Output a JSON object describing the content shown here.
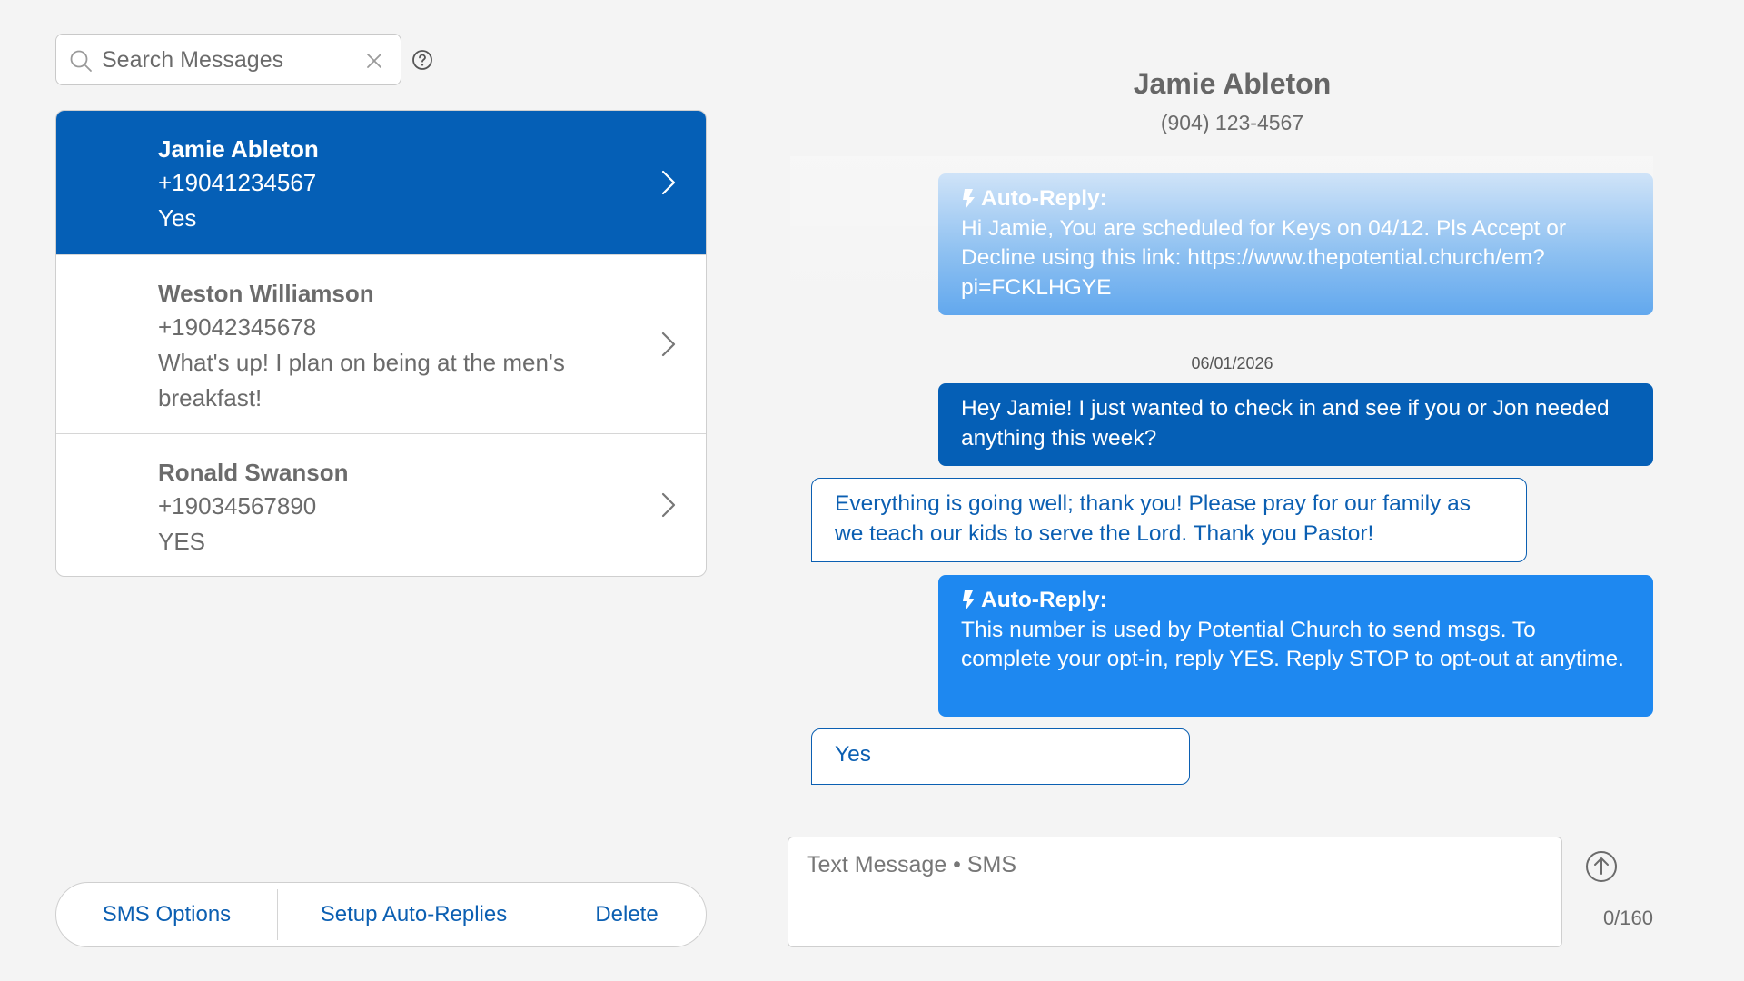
{
  "search": {
    "placeholder": "Search Messages"
  },
  "conversations": [
    {
      "name": "Jamie Ableton",
      "phone": "+19041234567",
      "preview": "Yes",
      "active": true
    },
    {
      "name": "Weston Williamson",
      "phone": "+19042345678",
      "preview": "What's up! I plan on being at the men's breakfast!",
      "active": false
    },
    {
      "name": "Ronald Swanson",
      "phone": "+19034567890",
      "preview": "YES",
      "active": false
    }
  ],
  "actions": {
    "sms_options": "SMS Options",
    "setup_auto_replies": "Setup Auto-Replies",
    "delete": "Delete"
  },
  "thread": {
    "contact_name": "Jamie Ableton",
    "contact_phone": "(904) 123-4567",
    "date_stamp": "06/01/2026",
    "messages": [
      {
        "direction": "out",
        "auto_reply": true,
        "label": "Auto-Reply:",
        "text": "Hi Jamie, You are scheduled for Keys on 04/12. Pls Accept or Decline using this link: https://www.thepotential.church/em?pi=FCKLHGYE"
      },
      {
        "direction": "out",
        "auto_reply": false,
        "text": "Hey Jamie! I just wanted to check in and see if you or Jon needed anything this week?"
      },
      {
        "direction": "in",
        "text": "Everything is going well; thank you! Please pray for our family as we teach our kids to serve the Lord. Thank you Pastor!"
      },
      {
        "direction": "out",
        "auto_reply": true,
        "label": "Auto-Reply:",
        "text": "This number is used by Potential Church to send msgs. To complete your opt-in, reply YES. Reply STOP to opt-out at anytime."
      },
      {
        "direction": "in",
        "text": "Yes"
      }
    ]
  },
  "composer": {
    "placeholder": "Text Message • SMS",
    "char_count": "0/160"
  },
  "colors": {
    "primary": "#055fb6",
    "auto_reply": "#1e88f0",
    "link_text": "#0b5fb2",
    "background": "#f4f4f4"
  },
  "icons": [
    "search-icon",
    "clear-icon",
    "help-icon",
    "chevron-right-icon",
    "bolt-icon",
    "send-icon"
  ]
}
